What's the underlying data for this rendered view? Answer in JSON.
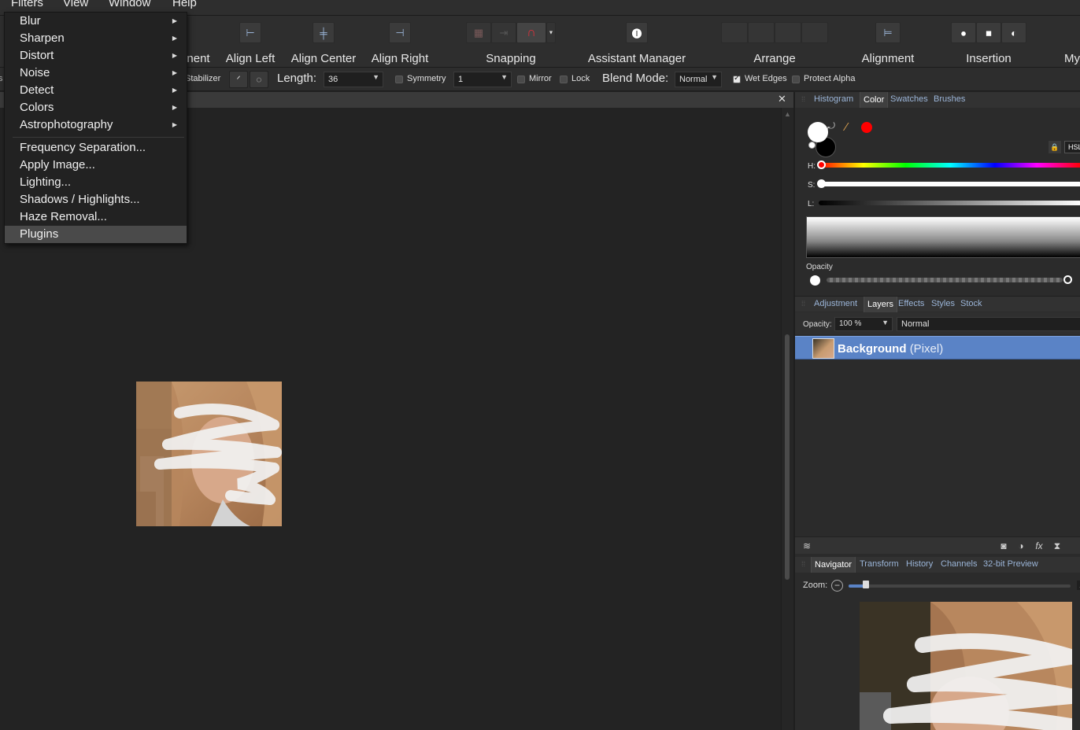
{
  "menubar": {
    "items": [
      "Filters",
      "View",
      "Window",
      "Help"
    ]
  },
  "toolbar": {
    "partial_label": "nent",
    "groups": [
      {
        "label": "Align Left",
        "icon": "align-left-icon"
      },
      {
        "label": "Align Center",
        "icon": "align-center-icon"
      },
      {
        "label": "Align Right",
        "icon": "align-right-icon"
      },
      {
        "label": "Snapping",
        "icon": "snapping-magnet-icon"
      },
      {
        "label": "Assistant Manager",
        "icon": "assistant-icon"
      },
      {
        "label": "Arrange",
        "icon": "arrange-icon"
      },
      {
        "label": "Alignment",
        "icon": "alignment-icon"
      },
      {
        "label": "Insertion",
        "icon": "insertion-icon"
      },
      {
        "label": "My",
        "icon": ""
      }
    ]
  },
  "contextbar": {
    "stabilizer_label": "Stabilizer",
    "length_label": "Length:",
    "length_value": "36",
    "symmetry_label": "Symmetry",
    "symmetry_value": "1",
    "mirror_label": "Mirror",
    "lock_label": "Lock",
    "blend_mode_label": "Blend Mode:",
    "blend_mode_value": "Normal",
    "wet_edges_label": "Wet Edges",
    "wet_edges_checked": true,
    "protect_alpha_label": "Protect Alpha",
    "protect_alpha_checked": false
  },
  "filters_menu": {
    "items": [
      {
        "label": "Blur",
        "submenu": true
      },
      {
        "label": "Sharpen",
        "submenu": true
      },
      {
        "label": "Distort",
        "submenu": true
      },
      {
        "label": "Noise",
        "submenu": true
      },
      {
        "label": "Detect",
        "submenu": true
      },
      {
        "label": "Colors",
        "submenu": true
      },
      {
        "label": "Astrophotography",
        "submenu": true
      },
      {
        "label": "Frequency Separation...",
        "submenu": false
      },
      {
        "label": "Apply Image...",
        "submenu": false
      },
      {
        "label": "Lighting...",
        "submenu": false
      },
      {
        "label": "Shadows / Highlights...",
        "submenu": false
      },
      {
        "label": "Haze Removal...",
        "submenu": false
      },
      {
        "label": "Plugins",
        "submenu": false,
        "highlighted": true
      }
    ]
  },
  "color_panel": {
    "tabs": [
      "Histogram",
      "Color",
      "Swatches",
      "Brushes"
    ],
    "active_tab": "Color",
    "mode_button": "HSL",
    "h_label": "H:",
    "s_label": "S:",
    "l_label": "L:",
    "opacity_label": "Opacity",
    "primary_color": "#ffffff",
    "secondary_color": "#000000",
    "picked_color": "#ff0000"
  },
  "layers_panel": {
    "tabs": [
      "Adjustment",
      "Layers",
      "Effects",
      "Styles",
      "Stock"
    ],
    "active_tab": "Layers",
    "opacity_label": "Opacity:",
    "opacity_value": "100 %",
    "blend_value": "Normal",
    "layers": [
      {
        "name": "Background",
        "kind": "(Pixel)",
        "selected": true
      }
    ]
  },
  "navigator_panel": {
    "tabs": [
      "Navigator",
      "Transform",
      "History",
      "Channels",
      "32-bit Preview"
    ],
    "active_tab": "Navigator",
    "zoom_label": "Zoom:",
    "zoom_right": "1"
  }
}
